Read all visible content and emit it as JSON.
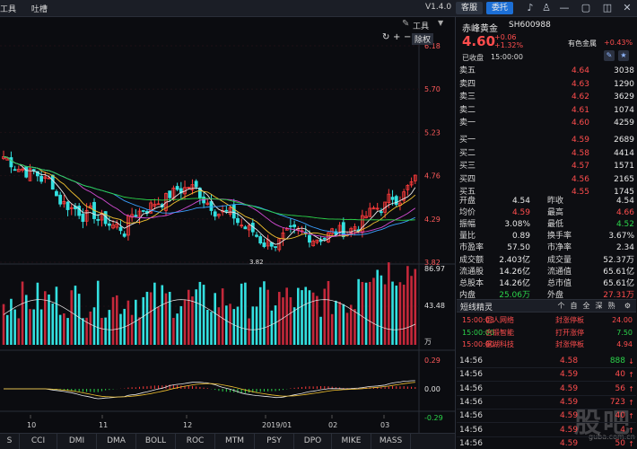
{
  "topbar": {
    "menu": [
      "工具",
      "吐槽"
    ],
    "version": "V1.4.0",
    "kefu": "客服",
    "weituo": "委托"
  },
  "chart": {
    "tool_label": "工具",
    "fq_label": "除权",
    "price_axis": [
      "6.18",
      "5.70",
      "5.23",
      "4.76",
      "4.29",
      "3.82"
    ],
    "low_mark": "3.82",
    "vol_axis": [
      "86.97",
      "43.48",
      "万"
    ],
    "macd_axis": [
      "0.29",
      "0.00",
      "-0.29"
    ],
    "date_labels": [
      "10",
      "11",
      "12",
      "2019/01",
      "02",
      "03"
    ],
    "ma_colors": {
      "ma5": "#e8e8e8",
      "ma10": "#f2c230",
      "ma20": "#d44cd4",
      "ma30": "#3aa0ff",
      "ma60": "#2bd44a"
    }
  },
  "tabs": [
    "S",
    "CCI",
    "DMI",
    "DMA",
    "BOLL",
    "ROC",
    "MTM",
    "PSY",
    "DPO",
    "MIKE",
    "MASS"
  ],
  "stock": {
    "name": "赤峰黄金",
    "code": "SH600988",
    "price": "4.60",
    "change": "+0.06",
    "change_pct": "+1.32%",
    "sector": "有色金属",
    "sector_pct": "+0.43%",
    "status": "已收盘",
    "time": "15:00:00"
  },
  "orderbook": {
    "asks": [
      {
        "label": "卖五",
        "price": "4.64",
        "vol": "3038"
      },
      {
        "label": "卖四",
        "price": "4.63",
        "vol": "1290"
      },
      {
        "label": "卖三",
        "price": "4.62",
        "vol": "3629"
      },
      {
        "label": "卖二",
        "price": "4.61",
        "vol": "1074"
      },
      {
        "label": "卖一",
        "price": "4.60",
        "vol": "4259"
      }
    ],
    "bids": [
      {
        "label": "买一",
        "price": "4.59",
        "vol": "2689"
      },
      {
        "label": "买二",
        "price": "4.58",
        "vol": "4414"
      },
      {
        "label": "买三",
        "price": "4.57",
        "vol": "1571"
      },
      {
        "label": "买四",
        "price": "4.56",
        "vol": "2165"
      },
      {
        "label": "买五",
        "price": "4.55",
        "vol": "1745"
      }
    ]
  },
  "stats": [
    {
      "l1": "开盘",
      "v1": "4.54",
      "c1": "white",
      "l2": "昨收",
      "v2": "4.54",
      "c2": "white"
    },
    {
      "l1": "均价",
      "v1": "4.59",
      "c1": "red",
      "l2": "最高",
      "v2": "4.66",
      "c2": "red"
    },
    {
      "l1": "振幅",
      "v1": "3.08%",
      "c1": "white",
      "l2": "最低",
      "v2": "4.52",
      "c2": "green"
    },
    {
      "l1": "量比",
      "v1": "0.89",
      "c1": "white",
      "l2": "换手率",
      "v2": "3.67%",
      "c2": "white"
    },
    {
      "l1": "市盈率",
      "v1": "57.50",
      "c1": "white",
      "l2": "市净率",
      "v2": "2.34",
      "c2": "white"
    },
    {
      "l1": "成交额",
      "v1": "2.403亿",
      "c1": "white",
      "l2": "成交量",
      "v2": "52.37万",
      "c2": "white"
    },
    {
      "l1": "流通股",
      "v1": "14.26亿",
      "c1": "white",
      "l2": "流通值",
      "v2": "65.61亿",
      "c2": "white"
    },
    {
      "l1": "总股本",
      "v1": "14.26亿",
      "c1": "white",
      "l2": "总市值",
      "v2": "65.61亿",
      "c2": "white"
    },
    {
      "l1": "内盘",
      "v1": "25.06万",
      "c1": "green",
      "l2": "外盘",
      "v2": "27.31万",
      "c2": "red"
    }
  ],
  "sprite": {
    "title": "短线精灵",
    "buttons": [
      "个",
      "自",
      "全",
      "深",
      "熟"
    ],
    "rows": [
      {
        "time": "15:00:03",
        "name": "巨人网络",
        "event": "封涨停板",
        "value": "24.00",
        "tc": "red",
        "vc": "red"
      },
      {
        "time": "15:00:00",
        "name": "合锻智能",
        "event": "打开涨停",
        "value": "7.50",
        "tc": "green",
        "vc": "green"
      },
      {
        "time": "15:00:00",
        "name": "星湖科技",
        "event": "封涨停板",
        "value": "4.94",
        "tc": "red",
        "vc": "red"
      }
    ]
  },
  "ticks": [
    {
      "time": "14:56",
      "price": "4.58",
      "vol": "888",
      "arrow": "↓",
      "ac": "green"
    },
    {
      "time": "14:56",
      "price": "4.59",
      "vol": "40",
      "arrow": "↑",
      "ac": "red"
    },
    {
      "time": "14:56",
      "price": "4.59",
      "vol": "56",
      "arrow": "↑",
      "ac": "red"
    },
    {
      "time": "14:56",
      "price": "4.59",
      "vol": "723",
      "arrow": "↑",
      "ac": "red"
    },
    {
      "time": "14:56",
      "price": "4.59",
      "vol": "40",
      "arrow": "↑",
      "ac": "red"
    },
    {
      "time": "14:56",
      "price": "4.59",
      "vol": "4",
      "arrow": "↑",
      "ac": "red"
    },
    {
      "time": "14:56",
      "price": "4.59",
      "vol": "50",
      "arrow": "↑",
      "ac": "red"
    }
  ],
  "watermark": {
    "text": "股吧",
    "url": "guba.com.cn"
  }
}
